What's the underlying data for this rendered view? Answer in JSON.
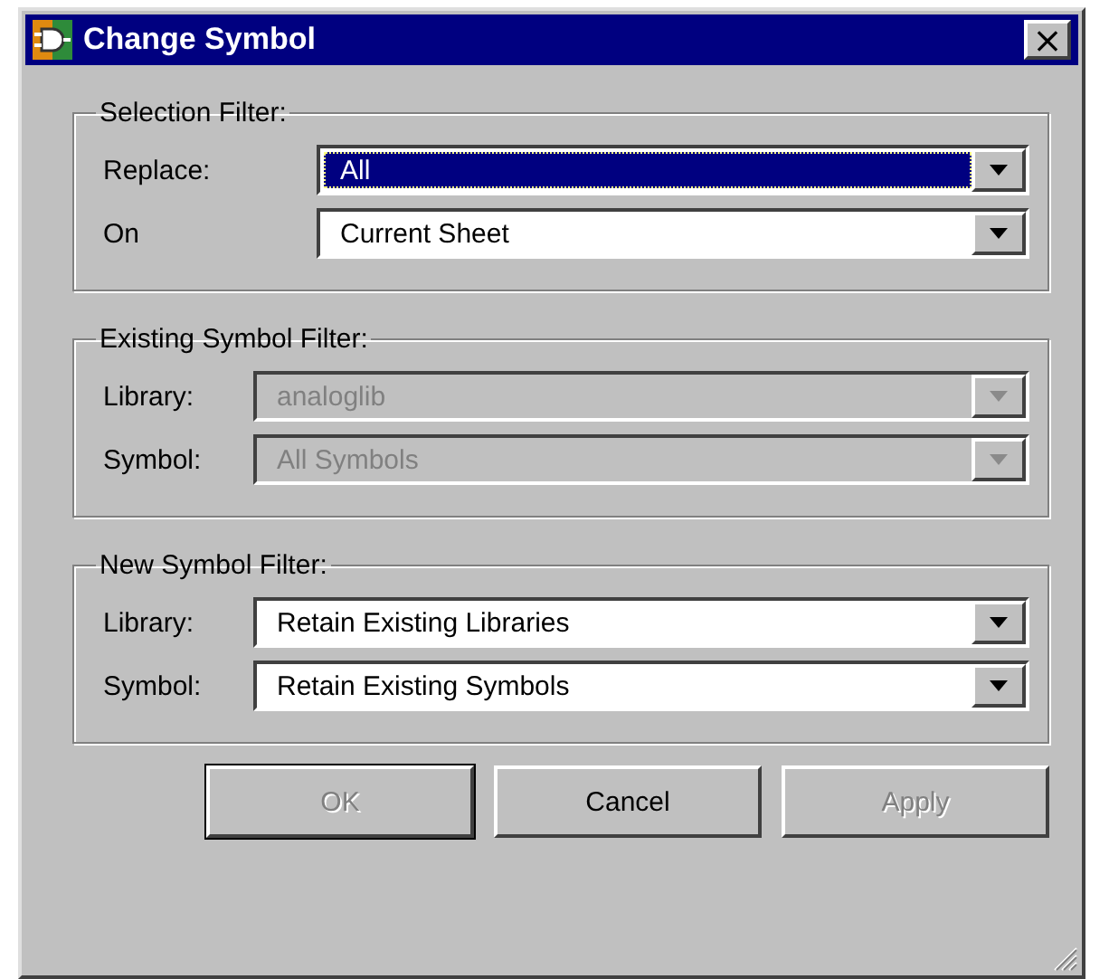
{
  "window": {
    "title": "Change Symbol",
    "close": "×"
  },
  "groups": [
    {
      "title": "Selection Filter:",
      "rows": [
        {
          "label": "Replace:",
          "value": "All",
          "focused": true,
          "disabled": false
        },
        {
          "label": "On",
          "value": "Current Sheet",
          "focused": false,
          "disabled": false
        }
      ]
    },
    {
      "title": "Existing Symbol Filter:",
      "rows": [
        {
          "label": "Library:",
          "value": "analoglib",
          "focused": false,
          "disabled": true
        },
        {
          "label": "Symbol:",
          "value": "All Symbols",
          "focused": false,
          "disabled": true
        }
      ]
    },
    {
      "title": "New Symbol Filter:",
      "rows": [
        {
          "label": "Library:",
          "value": "Retain Existing Libraries",
          "focused": false,
          "disabled": false
        },
        {
          "label": "Symbol:",
          "value": "Retain Existing Symbols",
          "focused": false,
          "disabled": false
        }
      ]
    }
  ],
  "buttons": [
    {
      "label": "OK",
      "disabled": true,
      "default": true
    },
    {
      "label": "Cancel",
      "disabled": false,
      "default": false
    },
    {
      "label": "Apply",
      "disabled": true,
      "default": false
    }
  ]
}
